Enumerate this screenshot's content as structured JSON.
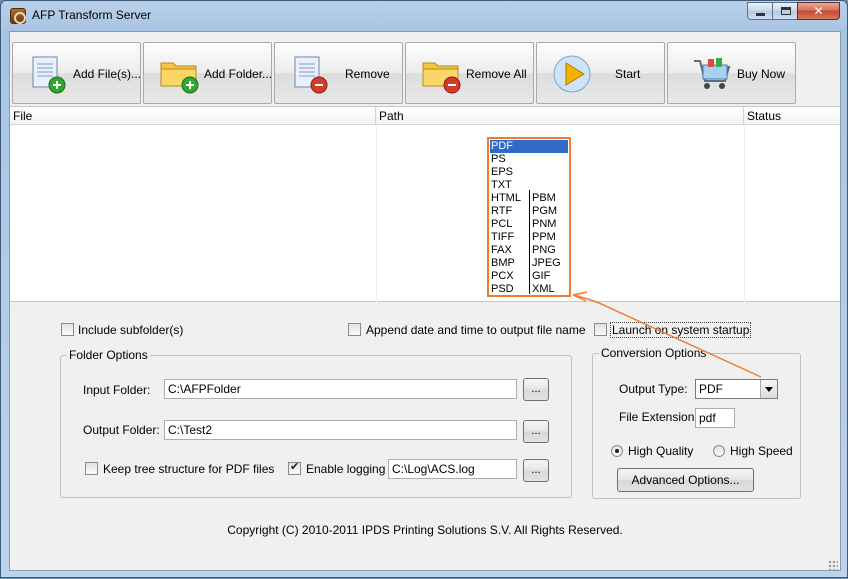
{
  "window": {
    "title": "AFP Transform Server"
  },
  "toolbar": {
    "add_files": "Add File(s)...",
    "add_folder": "Add Folder...",
    "remove": "Remove",
    "remove_all": "Remove All",
    "start": "Start",
    "buy_now": "Buy Now"
  },
  "file_list": {
    "columns": [
      "File",
      "Path",
      "Status"
    ]
  },
  "output_type_dropdown": {
    "selected": "PDF",
    "options_col1": [
      "PDF",
      "PS",
      "EPS",
      "TXT",
      "HTML",
      "RTF",
      "PCL",
      "TIFF",
      "FAX",
      "BMP",
      "PCX",
      "PSD"
    ],
    "options_col2": [
      "PBM",
      "PGM",
      "PNM",
      "PPM",
      "PNG",
      "JPEG",
      "GIF",
      "XML"
    ]
  },
  "options": {
    "include_subfolders": {
      "label": "Include subfolder(s)",
      "checked": false
    },
    "append_datetime": {
      "label": "Append date and time to output file name",
      "checked": false
    },
    "launch_startup": {
      "label": "Launch on system startup",
      "checked": false
    }
  },
  "folder_options": {
    "title": "Folder Options",
    "input_label": "Input Folder:",
    "input_value": "C:\\AFPFolder",
    "output_label": "Output Folder:",
    "output_value": "C:\\Test2",
    "keep_tree_label": "Keep tree structure for PDF files",
    "keep_tree_checked": false,
    "enable_logging_label": "Enable logging",
    "enable_logging_checked": true,
    "log_value": "C:\\Log\\ACS.log",
    "browse_label": "..."
  },
  "conversion_options": {
    "title": "Conversion Options",
    "output_type_label": "Output Type:",
    "output_type_value": "PDF",
    "file_ext_label": "File Extension:",
    "file_ext_value": "pdf",
    "high_quality_label": "High Quality",
    "high_speed_label": "High Speed",
    "quality_selected": "High Quality",
    "advanced_label": "Advanced Options..."
  },
  "footer": {
    "copyright": "Copyright (C) 2010-2011 IPDS Printing Solutions S.V.  All Rights Reserved."
  },
  "colors": {
    "highlight_orange": "#f07c32",
    "selection_blue": "#3169c6"
  }
}
